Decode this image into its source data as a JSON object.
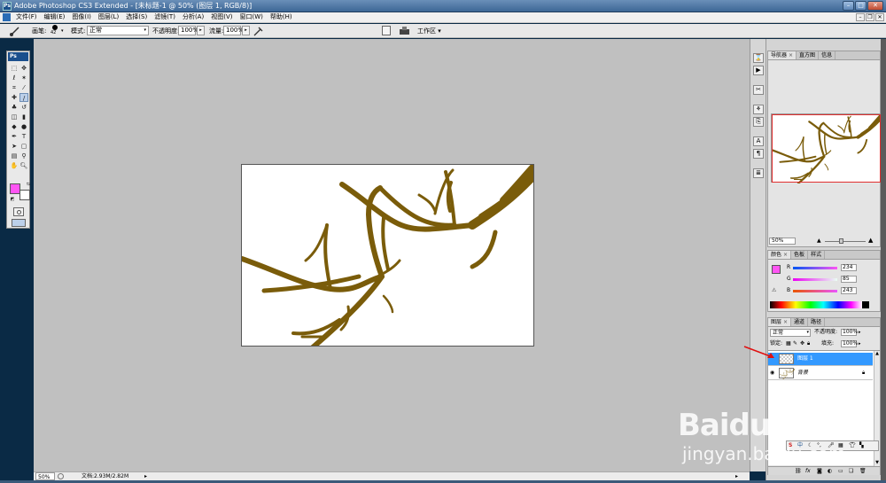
{
  "app": {
    "title": "Adobe Photoshop CS3 Extended - [未标题-1 @ 50% (图层 1, RGB/8)]",
    "icon_label": "Ps"
  },
  "menu": [
    "文件(F)",
    "编辑(E)",
    "图像(I)",
    "图层(L)",
    "选择(S)",
    "滤镜(T)",
    "分析(A)",
    "视图(V)",
    "窗口(W)",
    "帮助(H)"
  ],
  "options": {
    "brush_label": "画笔:",
    "brush_size": "42",
    "mode_label": "模式:",
    "mode_value": "正常",
    "opacity_label": "不透明度:",
    "opacity_value": "100%",
    "flow_label": "流量:",
    "flow_value": "100%",
    "workspace_label": "工作区 ▾"
  },
  "toolbox": {
    "header": "Ps",
    "foreground_color": "#ff55f3",
    "background_color": "#ffffff"
  },
  "navigator": {
    "tabs": [
      "导航器",
      "直方图",
      "信息"
    ],
    "zoom": "50%"
  },
  "color_panel": {
    "tabs": [
      "颜色",
      "色板",
      "样式"
    ],
    "r_label": "R",
    "r_value": "234",
    "g_label": "G",
    "g_value": "85",
    "b_label": "B",
    "b_value": "243"
  },
  "layers": {
    "tabs": [
      "图层",
      "通道",
      "路径"
    ],
    "blend_mode": "正常",
    "opacity_label": "不透明度:",
    "opacity_value": "100%",
    "lock_label": "锁定:",
    "fill_label": "填充:",
    "fill_value": "100%",
    "items": [
      {
        "name": "图层 1",
        "selected": true
      },
      {
        "name": "背景",
        "selected": false
      }
    ],
    "bottom_icons": [
      "link-icon",
      "fx-icon",
      "mask-icon",
      "adjustment-icon",
      "folder-icon",
      "new-layer-icon",
      "trash-icon"
    ]
  },
  "status": {
    "zoom": "50%",
    "doc_info": "文档:2.93M/2.82M"
  },
  "canvas": {
    "stroke_color": "#7a5c0a"
  },
  "watermark": {
    "line1": "Baidu经验",
    "line2": "jingyan.baidu.com"
  }
}
